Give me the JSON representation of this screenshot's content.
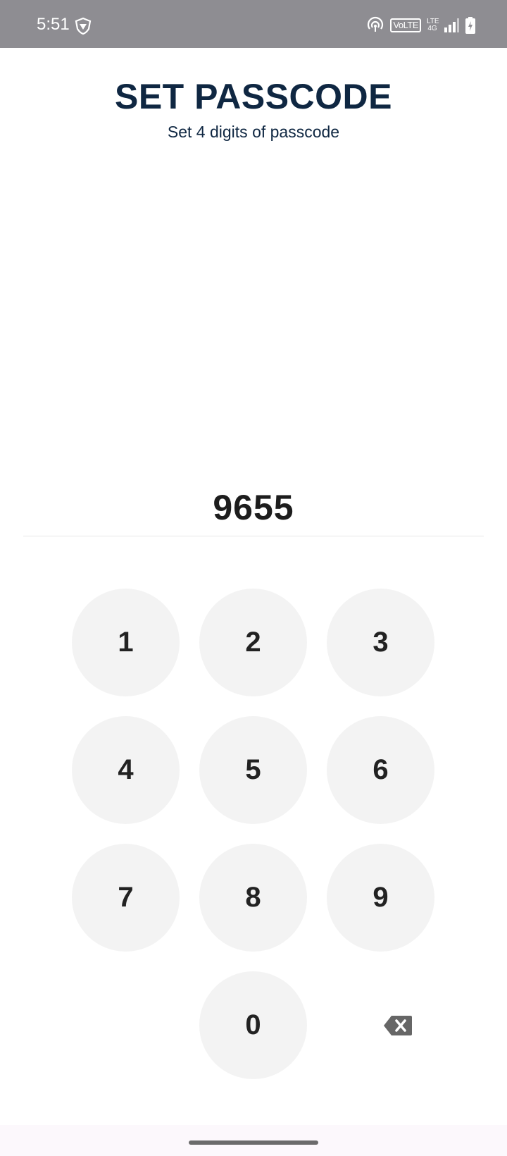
{
  "status_bar": {
    "time": "5:51",
    "volte": "VoLTE",
    "lte_top": "LTE",
    "lte_bottom": "4G",
    "icons": [
      "vpn-shield-icon",
      "hotspot-icon",
      "volte-icon",
      "lte-icon",
      "signal-icon",
      "battery-charging-icon"
    ]
  },
  "header": {
    "title": "SET PASSCODE",
    "subtitle": "Set 4 digits of passcode"
  },
  "passcode": {
    "value": "9655"
  },
  "keypad": {
    "keys": [
      "1",
      "2",
      "3",
      "4",
      "5",
      "6",
      "7",
      "8",
      "9",
      "0"
    ],
    "backspace_icon": "backspace-icon"
  },
  "colors": {
    "status_bar": "#8e8d92",
    "title": "#0f2742",
    "key_background": "#f3f3f3",
    "key_text": "#222222",
    "backspace": "#666666"
  }
}
